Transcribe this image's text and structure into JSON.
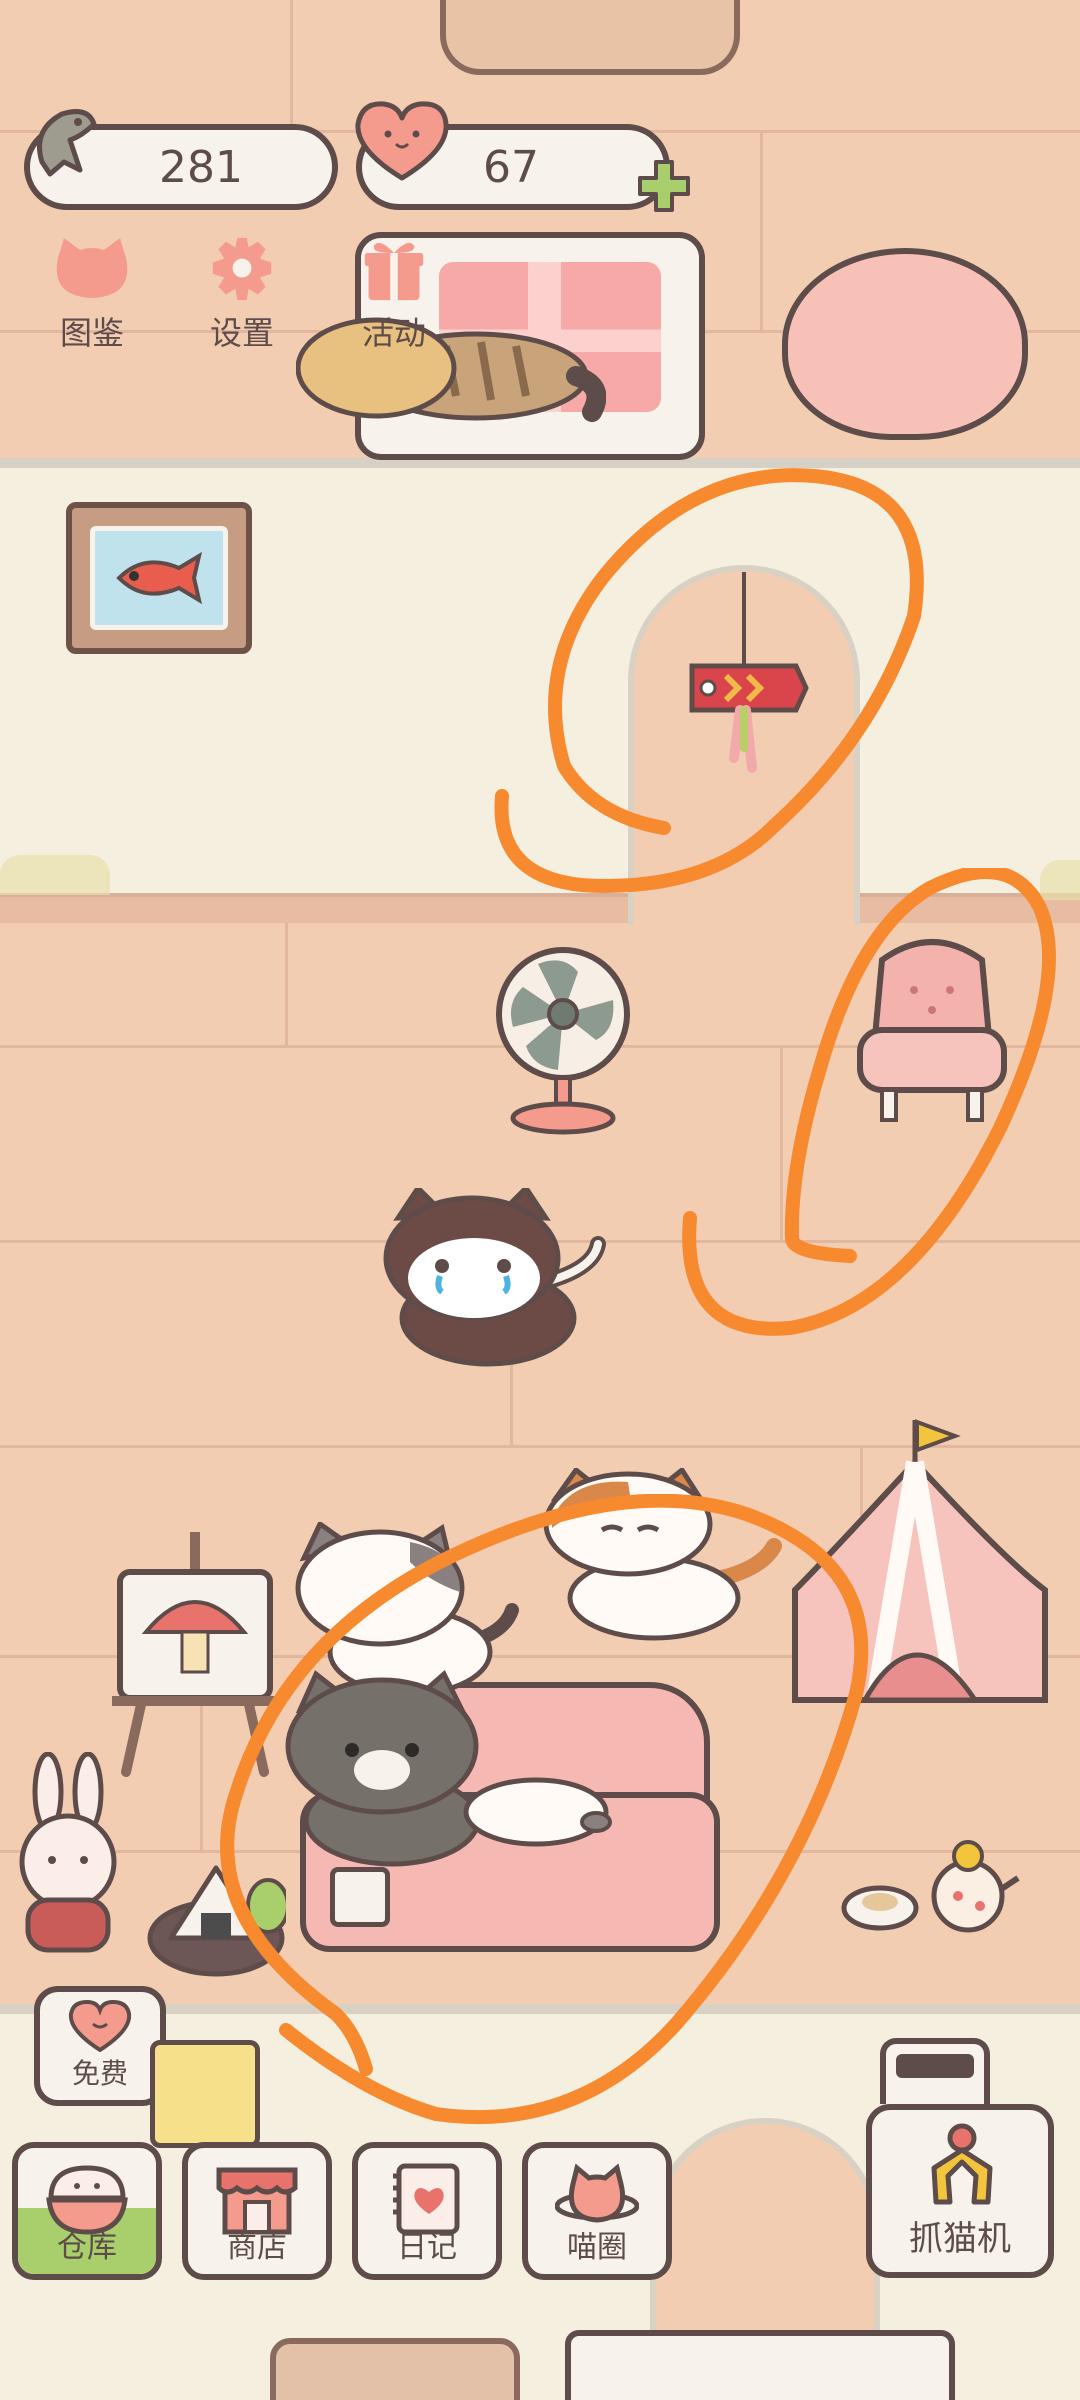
{
  "resources": {
    "fish_count": "281",
    "heart_count": "67"
  },
  "top_menu": [
    {
      "id": "collection",
      "label": "图鉴",
      "icon": "cat-head-icon"
    },
    {
      "id": "settings",
      "label": "设置",
      "icon": "gear-icon"
    },
    {
      "id": "events",
      "label": "活动",
      "icon": "gift-icon"
    }
  ],
  "free_button": {
    "label": "免费",
    "icon": "heart-icon"
  },
  "bottom_nav": [
    {
      "id": "warehouse",
      "label": "仓库",
      "icon": "rice-bowl-icon"
    },
    {
      "id": "shop",
      "label": "商店",
      "icon": "shop-icon"
    },
    {
      "id": "diary",
      "label": "日记",
      "icon": "diary-icon"
    },
    {
      "id": "meow_circle",
      "label": "喵圈",
      "icon": "cat-planet-icon"
    }
  ],
  "claw_machine": {
    "label": "抓猫机",
    "icon": "claw-icon"
  },
  "colors": {
    "outline": "#5d4c4a",
    "wall": "#f5efe0",
    "floor": "#f3cdb2",
    "accent_pink": "#f49b8e",
    "accent_green": "#a8cf6b",
    "marker_orange": "#f7892f"
  }
}
